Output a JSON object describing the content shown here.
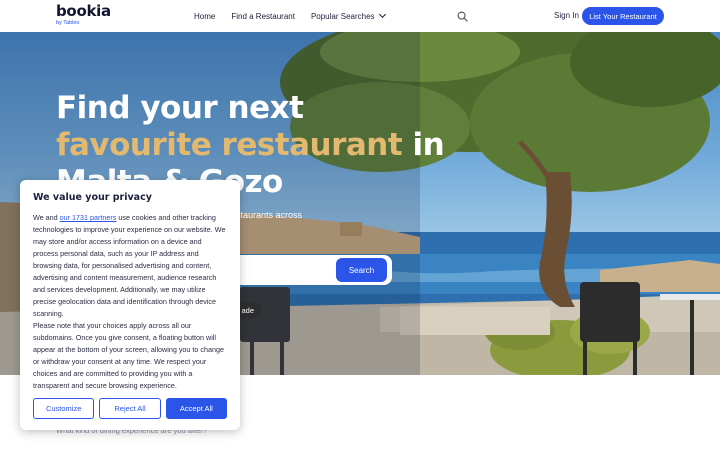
{
  "header": {
    "logo": "bookia",
    "logo_sub": "by Tableo",
    "nav": [
      "Home",
      "Find a Restaurant",
      "Popular Searches"
    ],
    "sign_in": "Sign In",
    "list_button": "List Your Restaurant",
    "icons": [
      "search-icon",
      "chevron-down-icon"
    ]
  },
  "hero": {
    "title_line1": "Find your next",
    "title_accent": "favourite restaurant",
    "title_in": " in",
    "title_line3": "Malta & Gozo",
    "subtitle_visible": "staurants across",
    "search_button": "Search",
    "pill_text": "ade"
  },
  "below": {
    "question": "What kind of dining experience are you after?"
  },
  "consent": {
    "title": "We value your privacy",
    "text_pre": "We and ",
    "partners_link": "our 1731 partners",
    "text_post": " use cookies and other tracking technologies to improve your experience on our website. We may store and/or access information on a device and process personal data, such as your IP address and browsing data, for personalised advertising and content, advertising and content measurement, audience research and services development. Additionally, we may utilize precise geolocation data and identification through device scanning.",
    "text_2": "Please note that your choices apply across all our subdomains. Once you give consent, a floating button will appear at the bottom of your screen, allowing you to change or withdraw your consent at any time. We respect your choices and are committed to providing you with a transparent and secure browsing experience.",
    "customize": "Customize",
    "reject": "Reject All",
    "accept": "Accept All"
  },
  "colors": {
    "brand_blue": "#2b55e8",
    "accent_gold": "#e3b86f",
    "text_dark": "#1b1f3b"
  }
}
